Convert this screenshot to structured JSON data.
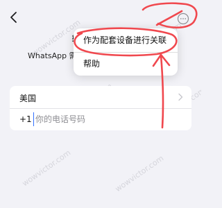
{
  "header": {
    "back_icon": "chevron-left-icon",
    "more_icon": "ellipsis-circle-icon",
    "title_partial": "输",
    "subtitle_partial": "WhatsApp 需要"
  },
  "menu": {
    "items": [
      {
        "label": "作为配套设备进行关联"
      },
      {
        "label": "帮助"
      }
    ]
  },
  "form": {
    "country": "美国",
    "dial_code": "+1",
    "phone_placeholder": "你的电话号码"
  },
  "watermark": {
    "text": "wowvictor.com"
  },
  "colors": {
    "annotation": "#f0484e",
    "background": "#f2f2f7",
    "cursor": "#2f6fff"
  }
}
